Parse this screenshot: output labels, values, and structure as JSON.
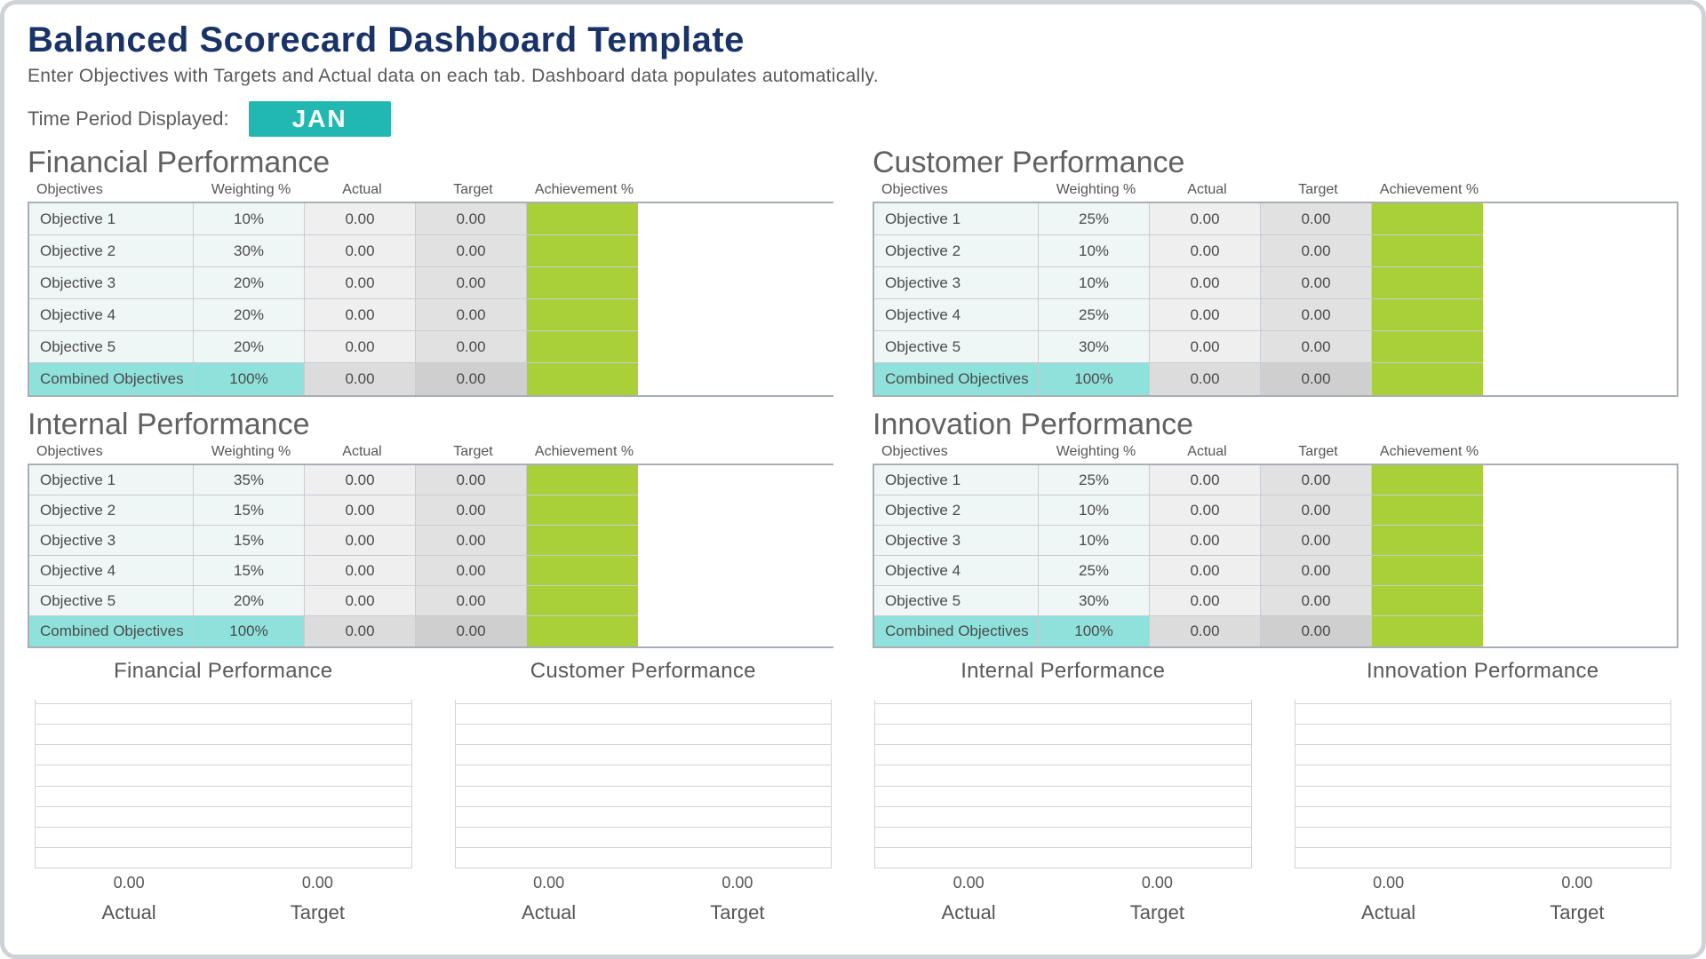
{
  "header": {
    "title": "Balanced Scorecard Dashboard Template",
    "subtitle": "Enter Objectives with Targets and Actual data on each tab. Dashboard data populates automatically.",
    "period_label": "Time Period Displayed:",
    "period_value": "JAN"
  },
  "columns": {
    "objectives": "Objectives",
    "weighting": "Weighting %",
    "actual": "Actual",
    "target": "Target",
    "achievement": "Achievement %"
  },
  "quadrants": [
    {
      "title": "Financial Performance",
      "rows": [
        {
          "obj": "Objective 1",
          "wt": "10%",
          "actual": "0.00",
          "target": "0.00",
          "ach": ""
        },
        {
          "obj": "Objective 2",
          "wt": "30%",
          "actual": "0.00",
          "target": "0.00",
          "ach": ""
        },
        {
          "obj": "Objective 3",
          "wt": "20%",
          "actual": "0.00",
          "target": "0.00",
          "ach": ""
        },
        {
          "obj": "Objective 4",
          "wt": "20%",
          "actual": "0.00",
          "target": "0.00",
          "ach": ""
        },
        {
          "obj": "Objective 5",
          "wt": "20%",
          "actual": "0.00",
          "target": "0.00",
          "ach": ""
        }
      ],
      "combined": {
        "obj": "Combined Objectives",
        "wt": "100%",
        "actual": "0.00",
        "target": "0.00",
        "ach": ""
      }
    },
    {
      "title": "Customer Performance",
      "rows": [
        {
          "obj": "Objective 1",
          "wt": "25%",
          "actual": "0.00",
          "target": "0.00",
          "ach": ""
        },
        {
          "obj": "Objective 2",
          "wt": "10%",
          "actual": "0.00",
          "target": "0.00",
          "ach": ""
        },
        {
          "obj": "Objective 3",
          "wt": "10%",
          "actual": "0.00",
          "target": "0.00",
          "ach": ""
        },
        {
          "obj": "Objective 4",
          "wt": "25%",
          "actual": "0.00",
          "target": "0.00",
          "ach": ""
        },
        {
          "obj": "Objective 5",
          "wt": "30%",
          "actual": "0.00",
          "target": "0.00",
          "ach": ""
        }
      ],
      "combined": {
        "obj": "Combined Objectives",
        "wt": "100%",
        "actual": "0.00",
        "target": "0.00",
        "ach": ""
      }
    },
    {
      "title": "Internal Performance",
      "rows": [
        {
          "obj": "Objective 1",
          "wt": "35%",
          "actual": "0.00",
          "target": "0.00",
          "ach": ""
        },
        {
          "obj": "Objective 2",
          "wt": "15%",
          "actual": "0.00",
          "target": "0.00",
          "ach": ""
        },
        {
          "obj": "Objective 3",
          "wt": "15%",
          "actual": "0.00",
          "target": "0.00",
          "ach": ""
        },
        {
          "obj": "Objective 4",
          "wt": "15%",
          "actual": "0.00",
          "target": "0.00",
          "ach": ""
        },
        {
          "obj": "Objective 5",
          "wt": "20%",
          "actual": "0.00",
          "target": "0.00",
          "ach": ""
        }
      ],
      "combined": {
        "obj": "Combined Objectives",
        "wt": "100%",
        "actual": "0.00",
        "target": "0.00",
        "ach": ""
      }
    },
    {
      "title": "Innovation Performance",
      "rows": [
        {
          "obj": "Objective 1",
          "wt": "25%",
          "actual": "0.00",
          "target": "0.00",
          "ach": ""
        },
        {
          "obj": "Objective 2",
          "wt": "10%",
          "actual": "0.00",
          "target": "0.00",
          "ach": ""
        },
        {
          "obj": "Objective 3",
          "wt": "10%",
          "actual": "0.00",
          "target": "0.00",
          "ach": ""
        },
        {
          "obj": "Objective 4",
          "wt": "25%",
          "actual": "0.00",
          "target": "0.00",
          "ach": ""
        },
        {
          "obj": "Objective 5",
          "wt": "30%",
          "actual": "0.00",
          "target": "0.00",
          "ach": ""
        }
      ],
      "combined": {
        "obj": "Combined Objectives",
        "wt": "100%",
        "actual": "0.00",
        "target": "0.00",
        "ach": ""
      }
    }
  ],
  "charts": [
    {
      "title": "Financial Performance",
      "actual_val": "0.00",
      "target_val": "0.00",
      "actual_lbl": "Actual",
      "target_lbl": "Target"
    },
    {
      "title": "Customer Performance",
      "actual_val": "0.00",
      "target_val": "0.00",
      "actual_lbl": "Actual",
      "target_lbl": "Target"
    },
    {
      "title": "Internal Performance",
      "actual_val": "0.00",
      "target_val": "0.00",
      "actual_lbl": "Actual",
      "target_lbl": "Target"
    },
    {
      "title": "Innovation Performance",
      "actual_val": "0.00",
      "target_val": "0.00",
      "actual_lbl": "Actual",
      "target_lbl": "Target"
    }
  ],
  "chart_data": [
    {
      "type": "bar",
      "title": "Financial Performance",
      "categories": [
        "Actual",
        "Target"
      ],
      "values": [
        0.0,
        0.0
      ],
      "ylim": [
        0,
        1
      ]
    },
    {
      "type": "bar",
      "title": "Customer Performance",
      "categories": [
        "Actual",
        "Target"
      ],
      "values": [
        0.0,
        0.0
      ],
      "ylim": [
        0,
        1
      ]
    },
    {
      "type": "bar",
      "title": "Internal Performance",
      "categories": [
        "Actual",
        "Target"
      ],
      "values": [
        0.0,
        0.0
      ],
      "ylim": [
        0,
        1
      ]
    },
    {
      "type": "bar",
      "title": "Innovation Performance",
      "categories": [
        "Actual",
        "Target"
      ],
      "values": [
        0.0,
        0.0
      ],
      "ylim": [
        0,
        1
      ]
    }
  ]
}
